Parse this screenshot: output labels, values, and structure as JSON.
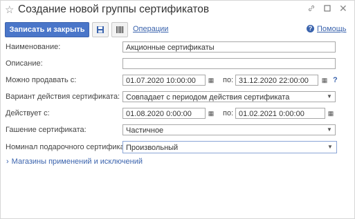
{
  "window": {
    "title": "Создание новой группы сертификатов"
  },
  "toolbar": {
    "save_close_label": "Записать и закрыть",
    "operations_label": "Операции",
    "help_label": "Помощь",
    "help_icon_glyph": "?"
  },
  "form": {
    "name_label": "Наименование:",
    "name_value": "Акционные сертификаты",
    "description_label": "Описание:",
    "description_value": "",
    "sell_label": "Можно продавать с:",
    "sell_from": "01.07.2020 10:00:00",
    "to_label": "по:",
    "sell_to": "31.12.2020 22:00:00",
    "hint_glyph": "?",
    "variant_label": "Вариант действия сертификата:",
    "variant_value": "Совпадает с периодом действия сертификата",
    "valid_label": "Действует с:",
    "valid_from": "01.08.2020  0:00:00",
    "valid_to": "01.02.2021  0:00:00",
    "redemption_label": "Гашение сертификата:",
    "redemption_value": "Частичное",
    "nominal_label": "Номинал подарочного сертификата:",
    "nominal_value": "Произвольный"
  },
  "section": {
    "stores_label": "Магазины применений и исключений"
  },
  "icons": [
    "star-icon",
    "link-icon",
    "minimize-icon",
    "close-icon",
    "save-icon",
    "barcode-icon",
    "calendar-icon",
    "chevron-down-icon",
    "chevron-right-icon"
  ]
}
